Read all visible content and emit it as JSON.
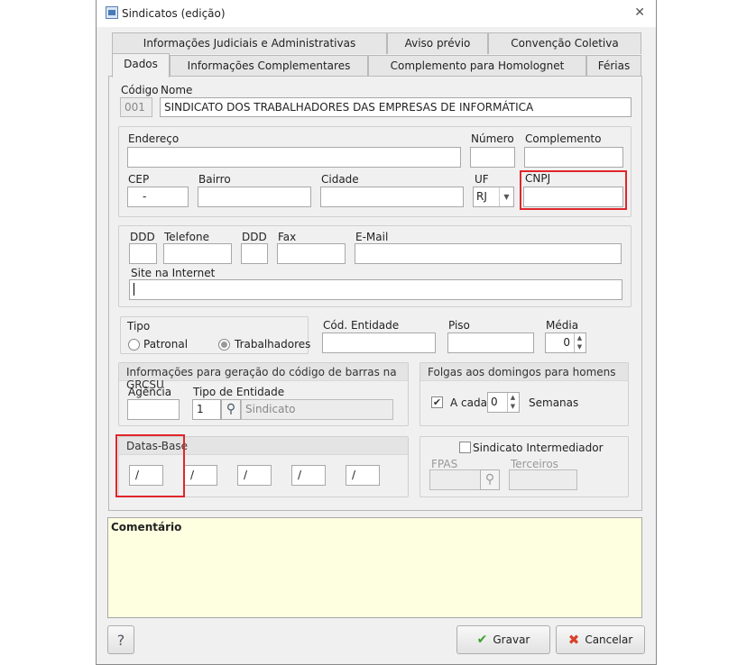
{
  "window": {
    "title": "Sindicatos (edição)",
    "close_glyph": "✕"
  },
  "tabs": {
    "row1": [
      "Informações Judiciais e Administrativas",
      "Aviso prévio",
      "Convenção Coletiva"
    ],
    "row2": [
      "Dados",
      "Informações Complementares",
      "Complemento para Homolognet",
      "Férias"
    ]
  },
  "form": {
    "codigo_label": "Código",
    "codigo_value": "001",
    "nome_label": "Nome",
    "nome_value": "SINDICATO DOS TRABALHADORES DAS EMPRESAS DE INFORMÁTICA",
    "endereco_label": "Endereço",
    "numero_label": "Número",
    "complemento_label": "Complemento",
    "cep_label": "CEP",
    "cep_value": "-",
    "bairro_label": "Bairro",
    "cidade_label": "Cidade",
    "uf_label": "UF",
    "uf_value": "RJ",
    "cnpj_label": "CNPJ",
    "ddd_label": "DDD",
    "telefone_label": "Telefone",
    "ddd2_label": "DDD",
    "fax_label": "Fax",
    "email_label": "E-Mail",
    "site_label": "Site na Internet",
    "tipo_label": "Tipo",
    "patronal_label": "Patronal",
    "trabalhadores_label": "Trabalhadores",
    "cod_entidade_label": "Cód. Entidade",
    "piso_label": "Piso",
    "media_label": "Média",
    "media_value": "0",
    "grcsu_title": "Informações para geração do código de barras na GRCSU",
    "agencia_label": "Agência",
    "tipo_entidade_label": "Tipo de Entidade",
    "tipo_entidade_value": "1",
    "tipo_entidade_desc": "Sindicato",
    "folgas_title": "Folgas aos domingos para homens",
    "a_cada_label": "A cada",
    "a_cada_value": "0",
    "semanas_label": "Semanas",
    "datas_base_title": "Datas-Base",
    "datas_base_values": [
      "/",
      "/",
      "/",
      "/",
      "/"
    ],
    "sindicato_intermediador_label": "Sindicato Intermediador",
    "fpas_label": "FPAS",
    "terceiros_label": "Terceiros"
  },
  "comment": {
    "label": "Comentário"
  },
  "footer": {
    "help_label": "?",
    "save_label": "Gravar",
    "cancel_label": "Cancelar"
  },
  "colors": {
    "highlight": "#e0262b",
    "comment_bg": "#fefee0"
  }
}
